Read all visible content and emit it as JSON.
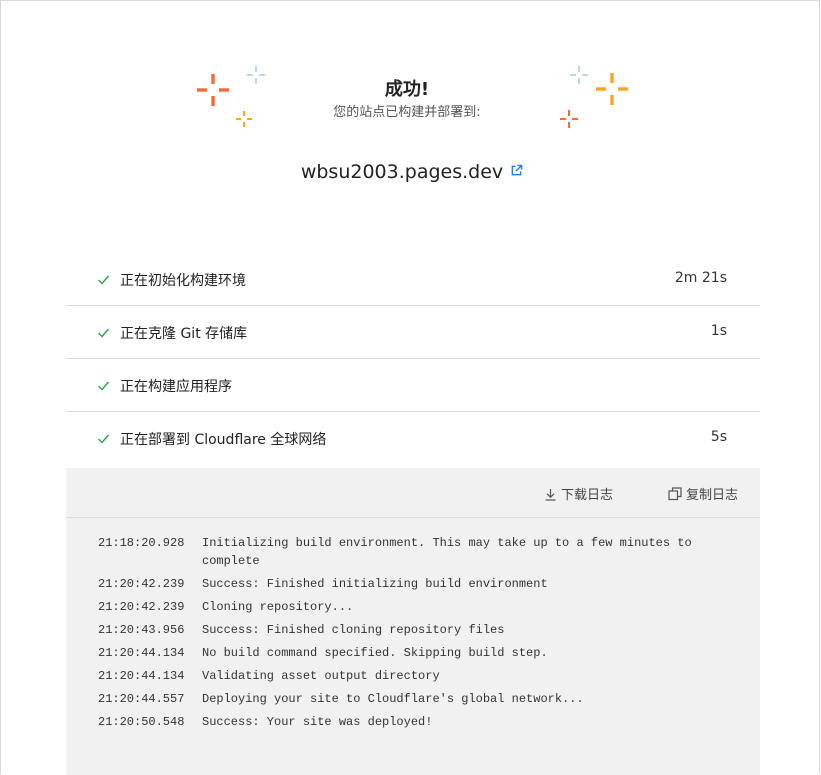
{
  "header": {
    "title": "成功!",
    "subtitle": "您的站点已构建并部署到:",
    "domain": "wbsu2003.pages.dev"
  },
  "steps": [
    {
      "label": "正在初始化构建环境",
      "duration": "2m 21s"
    },
    {
      "label": "正在克隆 Git 存储库",
      "duration": "1s"
    },
    {
      "label": "正在构建应用程序",
      "duration": ""
    },
    {
      "label": "正在部署到 Cloudflare 全球网络",
      "duration": "5s"
    }
  ],
  "log_toolbar": {
    "download_label": "下载日志",
    "copy_label": "复制日志"
  },
  "log_lines": [
    {
      "time": "21:18:20.928",
      "message": "Initializing build environment. This may take up to a few minutes to complete"
    },
    {
      "time": "21:20:42.239",
      "message": "Success: Finished initializing build environment"
    },
    {
      "time": "21:20:42.239",
      "message": "Cloning repository..."
    },
    {
      "time": "21:20:43.956",
      "message": "Success: Finished cloning repository files"
    },
    {
      "time": "21:20:44.134",
      "message": "No build command specified. Skipping build step."
    },
    {
      "time": "21:20:44.134",
      "message": "Validating asset output directory"
    },
    {
      "time": "21:20:44.557",
      "message": "Deploying your site to Cloudflare's global network..."
    },
    {
      "time": "21:20:50.548",
      "message": "Success: Your site was deployed!"
    }
  ],
  "icons": {
    "step_status": "check-icon",
    "external_link": "external-link-icon",
    "download": "download-icon",
    "copy": "copy-icon",
    "sparkles": "sparkle-icon"
  },
  "colors": {
    "check": "#2e9e4f",
    "link_icon": "#2f7bd9",
    "sparkle_orange": "#f26b3a",
    "sparkle_yellow": "#f5a623",
    "sparkle_blue": "#b9d8ef",
    "log_background": "#f1f1f1"
  }
}
